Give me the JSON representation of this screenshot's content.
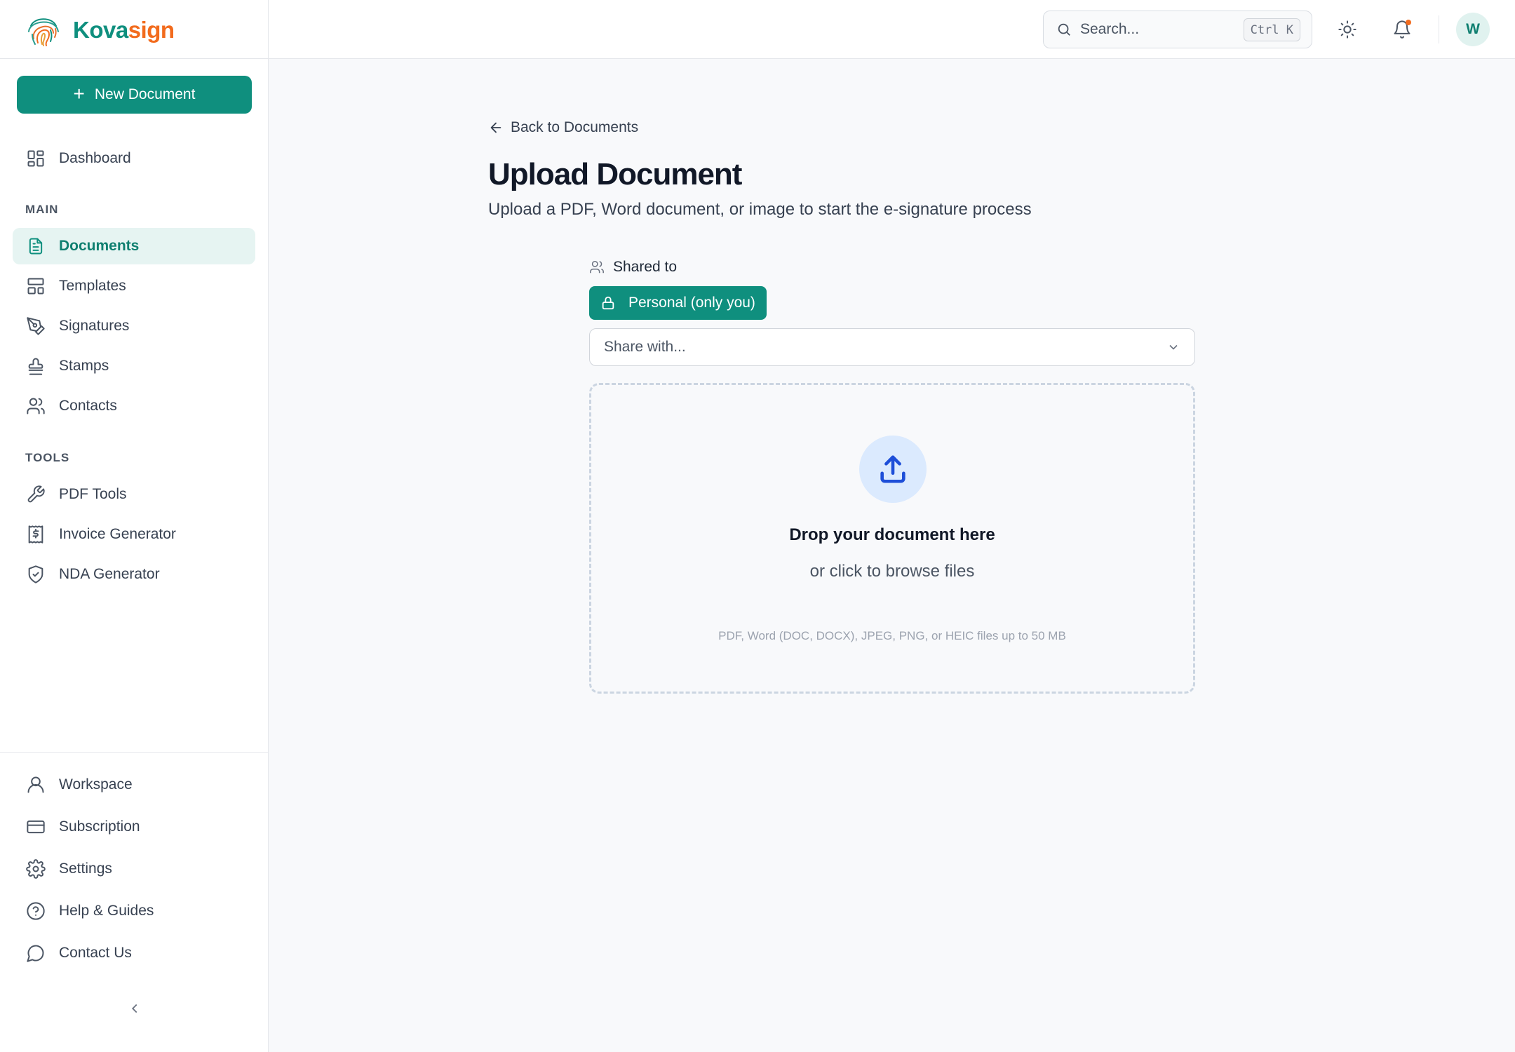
{
  "brand": {
    "part1": "Kova",
    "part2": "sign",
    "color_primary": "#0f8f7e",
    "color_accent": "#f26b1d"
  },
  "sidebar": {
    "new_document_label": "New Document",
    "dashboard": {
      "label": "Dashboard",
      "icon": "dashboard-icon"
    },
    "main_label": "MAIN",
    "main_items": [
      {
        "label": "Documents",
        "icon": "document-icon",
        "active": true
      },
      {
        "label": "Templates",
        "icon": "template-icon"
      },
      {
        "label": "Signatures",
        "icon": "pen-icon"
      },
      {
        "label": "Stamps",
        "icon": "stamp-icon"
      },
      {
        "label": "Contacts",
        "icon": "users-icon"
      }
    ],
    "tools_label": "TOOLS",
    "tools_items": [
      {
        "label": "PDF Tools",
        "icon": "wrench-icon"
      },
      {
        "label": "Invoice Generator",
        "icon": "invoice-icon"
      },
      {
        "label": "NDA Generator",
        "icon": "shield-icon"
      }
    ],
    "bottom_items": [
      {
        "label": "Workspace",
        "icon": "user-icon"
      },
      {
        "label": "Subscription",
        "icon": "credit-card-icon"
      },
      {
        "label": "Settings",
        "icon": "gear-icon"
      },
      {
        "label": "Help & Guides",
        "icon": "help-icon"
      },
      {
        "label": "Contact Us",
        "icon": "chat-icon"
      }
    ]
  },
  "topbar": {
    "search_placeholder": "Search...",
    "search_shortcut": "Ctrl K",
    "avatar_initial": "W"
  },
  "main": {
    "back_label": "Back to Documents",
    "title": "Upload Document",
    "subtitle": "Upload a PDF, Word document, or image to start the e-signature process",
    "shared_to_label": "Shared to",
    "personal_chip": "Personal (only you)",
    "share_with_placeholder": "Share with...",
    "drop_title": "Drop your document here",
    "drop_sub": "or click to browse files",
    "drop_hint": "PDF, Word (DOC, DOCX), JPEG, PNG, or HEIC files up to 50 MB"
  }
}
